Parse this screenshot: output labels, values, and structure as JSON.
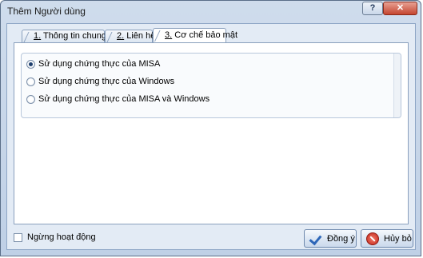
{
  "window": {
    "title": "Thêm Người dùng",
    "help_label": "?",
    "close_label": "✕"
  },
  "tabs": [
    {
      "num": "1.",
      "label": " Thông tin chung"
    },
    {
      "num": "2.",
      "label": " Liên hệ"
    },
    {
      "num": "3.",
      "label": " Cơ chế bảo mật"
    }
  ],
  "auth_options": [
    {
      "label": "Sử dụng chứng thực của MISA",
      "checked": true
    },
    {
      "label": "Sử dụng chứng thực của Windows",
      "checked": false
    },
    {
      "label": "Sử dụng chứng thực của MISA và Windows",
      "checked": false
    }
  ],
  "footer": {
    "inactive_label": "Ngừng hoạt động",
    "inactive_checked": false,
    "ok_label": "Đồng ý",
    "cancel_label": "Hủy bỏ"
  }
}
